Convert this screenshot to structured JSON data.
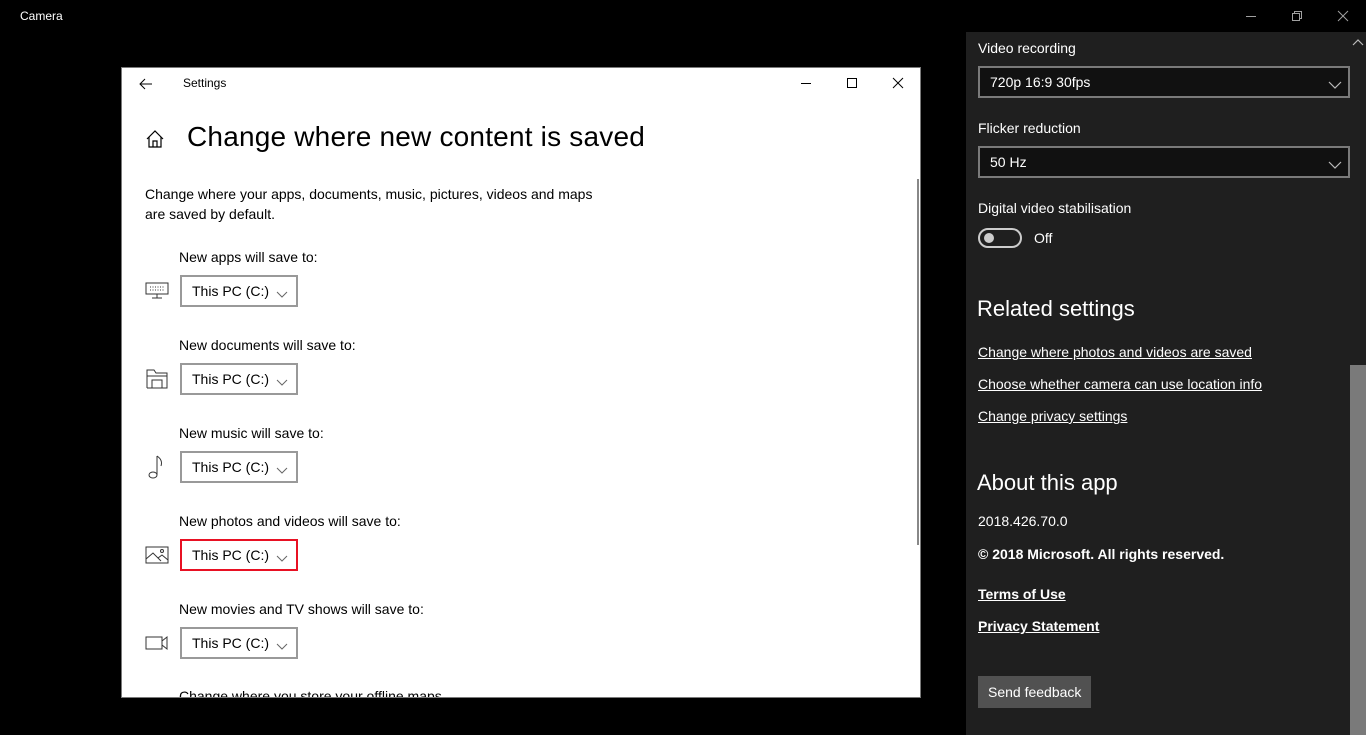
{
  "app": {
    "title": "Camera"
  },
  "settings_window": {
    "title": "Settings",
    "page_title": "Change where new content is saved",
    "description": "Change where your apps, documents, music, pictures, videos and maps are saved by default.",
    "rows": [
      {
        "label": "New apps will save to:",
        "icon": "keyboard-icon",
        "value": "This PC (C:)",
        "focused": false
      },
      {
        "label": "New documents will save to:",
        "icon": "folder-icon",
        "value": "This PC (C:)",
        "focused": false
      },
      {
        "label": "New music will save to:",
        "icon": "music-note-icon",
        "value": "This PC (C:)",
        "focused": false
      },
      {
        "label": "New photos and videos will save to:",
        "icon": "image-icon",
        "value": "This PC (C:)",
        "focused": true
      },
      {
        "label": "New movies and TV shows will save to:",
        "icon": "video-camera-icon",
        "value": "This PC (C:)",
        "focused": false
      }
    ],
    "cut_off_label": "Change where you store your offline maps"
  },
  "panel": {
    "video_recording": {
      "label": "Video recording",
      "value": "720p 16:9 30fps"
    },
    "flicker_reduction": {
      "label": "Flicker reduction",
      "value": "50 Hz"
    },
    "stabilisation": {
      "label": "Digital video stabilisation",
      "state": "Off",
      "on": false
    },
    "related_settings": {
      "heading": "Related settings",
      "links": [
        "Change where photos and videos are saved",
        "Choose whether camera can use location info",
        "Change privacy settings"
      ]
    },
    "about": {
      "heading": "About this app",
      "version": "2018.426.70.0",
      "copyright": "© 2018 Microsoft. All rights reserved.",
      "terms": "Terms of Use",
      "privacy": "Privacy Statement"
    },
    "feedback_button": "Send feedback"
  }
}
